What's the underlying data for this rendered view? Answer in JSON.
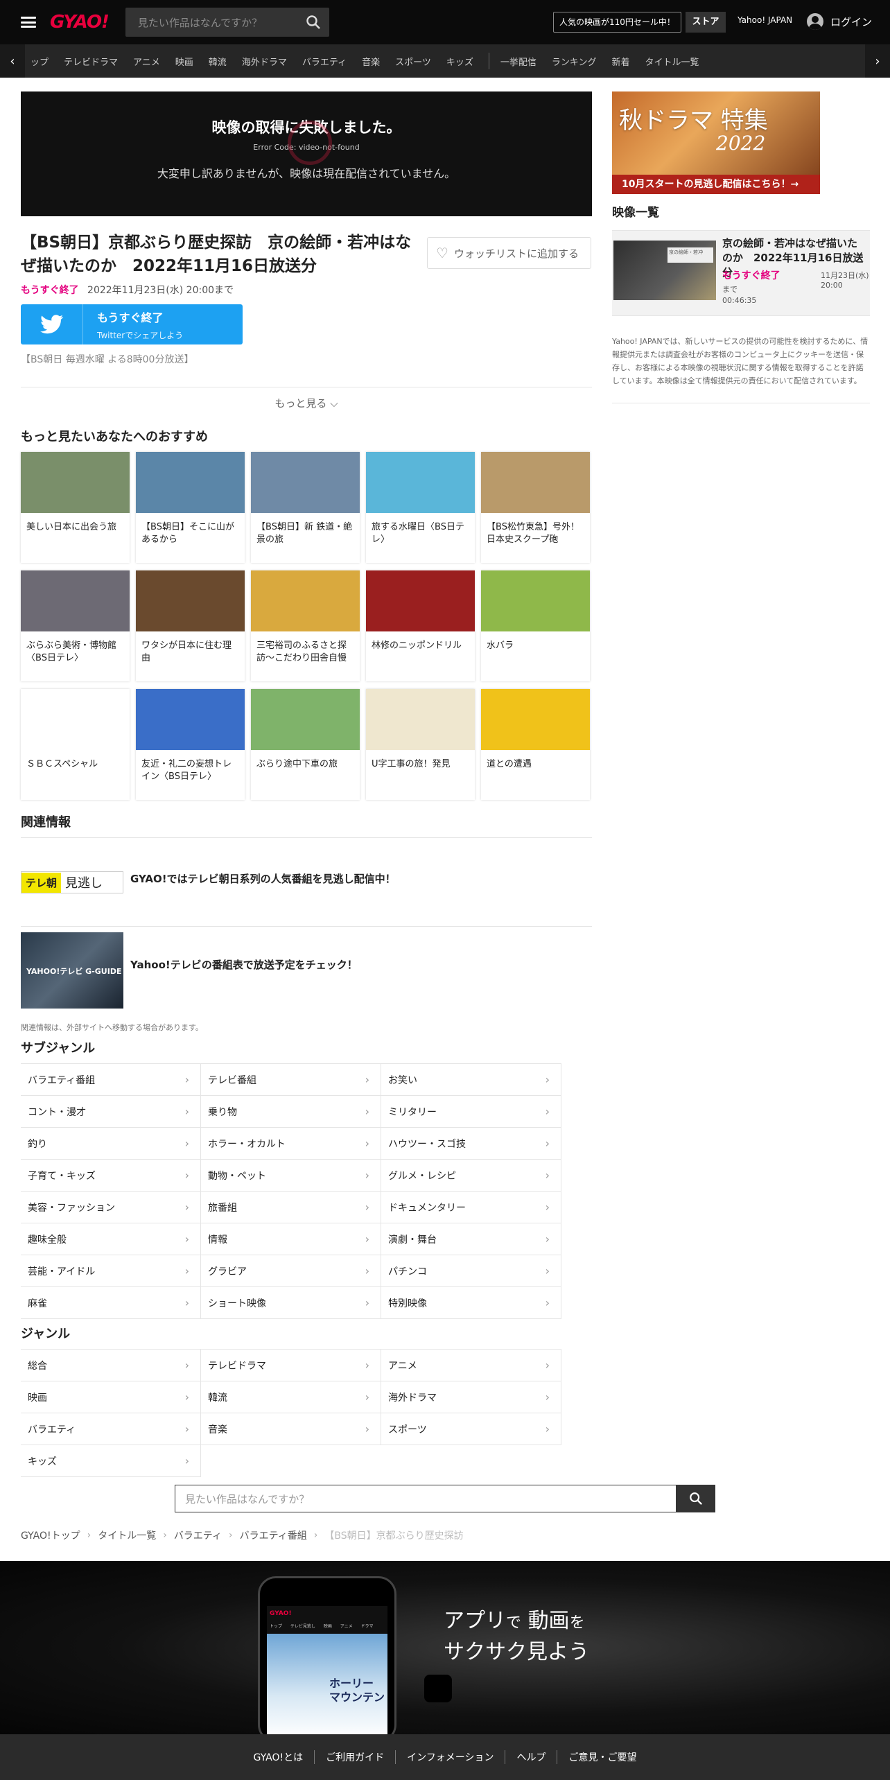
{
  "header": {
    "logo": "GYAO!",
    "search_placeholder": "見たい作品はなんですか？",
    "sale_text": "人気の映画が110円セール中！",
    "store": "ストア",
    "yahoo": "Yahoo! JAPAN",
    "login": "ログイン"
  },
  "nav": {
    "items": [
      "ップ",
      "テレビドラマ",
      "アニメ",
      "映画",
      "韓流",
      "海外ドラマ",
      "バラエティ",
      "音楽",
      "スポーツ",
      "キッズ"
    ],
    "items2": [
      "一挙配信",
      "ランキング",
      "新着",
      "タイトル一覧"
    ]
  },
  "player": {
    "error_title": "映像の取得に失敗しました。",
    "error_code": "Error Code: video-not-found",
    "error_msg": "大変申し訳ありませんが、映像は現在配信されていません。"
  },
  "video": {
    "title": "【BS朝日】京都ぶらり歴史探訪　京の絵師・若冲はなぜ描いたのか　2022年11月16日放送分",
    "watchlist": "ウォッチリストに追加する",
    "status": "もうすぐ終了",
    "until": "2022年11月23日(水) 20:00まで",
    "twitter_l1": "もうすぐ終了",
    "twitter_l2": "Twitterでシェアしよう",
    "broadcast": "【BS朝日 毎週水曜 よる8時00分放送】",
    "more": "もっと見る"
  },
  "recommend": {
    "heading": "もっと見たいあなたへのおすすめ",
    "rows": [
      [
        {
          "title": "美しい日本に出会う旅",
          "color": "#7a8f6a"
        },
        {
          "title": "【BS朝日】そこに山があるから",
          "color": "#5b86a8"
        },
        {
          "title": "【BS朝日】新 鉄道・絶景の旅",
          "color": "#6f8aa6"
        },
        {
          "title": "旅する水曜日〈BS日テレ〉",
          "color": "#5ab6d9"
        },
        {
          "title": "【BS松竹東急】号外！日本史スクープ砲",
          "color": "#b99a6a"
        }
      ],
      [
        {
          "title": "ぶらぶら美術・博物館〈BS日テレ〉",
          "color": "#6d6a74"
        },
        {
          "title": "ワタシが日本に住む理由",
          "color": "#6a4a2e"
        },
        {
          "title": "三宅裕司のふるさと探訪～こだわり田舎自慢",
          "color": "#d9a93e"
        },
        {
          "title": "林修のニッポンドリル",
          "color": "#9a1f1f"
        },
        {
          "title": "水バラ",
          "color": "#8fb84a"
        }
      ],
      [
        {
          "title": "ＳＢＣスペシャル",
          "color": "#ffffff"
        },
        {
          "title": "友近・礼二の妄想トレイン〈BS日テレ〉",
          "color": "#3a6ec8"
        },
        {
          "title": "ぶらり途中下車の旅",
          "color": "#7fb36a"
        },
        {
          "title": "U字工事の旅！発見",
          "color": "#efe7cf"
        },
        {
          "title": "道との遭遇",
          "color": "#f0c21a"
        }
      ]
    ]
  },
  "related": {
    "heading": "関連情報",
    "items": [
      {
        "text": "GYAO!ではテレビ朝日系列の人気番組を見逃し配信中！",
        "img_label": "テレ朝 見逃し"
      },
      {
        "text": "Yahoo!テレビの番組表で放送予定をチェック！",
        "img_label": "YAHOO!テレビ G-GUIDE"
      }
    ],
    "note": "関連情報は、外部サイトへ移動する場合があります。"
  },
  "subgenre": {
    "heading": "サブジャンル",
    "items": [
      "バラエティ番組",
      "テレビ番組",
      "お笑い",
      "コント・漫才",
      "乗り物",
      "ミリタリー",
      "釣り",
      "ホラー・オカルト",
      "ハウツー・スゴ技",
      "子育て・キッズ",
      "動物・ペット",
      "グルメ・レシピ",
      "美容・ファッション",
      "旅番組",
      "ドキュメンタリー",
      "趣味全般",
      "情報",
      "演劇・舞台",
      "芸能・アイドル",
      "グラビア",
      "パチンコ",
      "麻雀",
      "ショート映像",
      "特別映像"
    ]
  },
  "genre": {
    "heading": "ジャンル",
    "items": [
      "総合",
      "テレビドラマ",
      "アニメ",
      "映画",
      "韓流",
      "海外ドラマ",
      "バラエティ",
      "音楽",
      "スポーツ",
      "キッズ"
    ]
  },
  "bottom_search_placeholder": "見たい作品はなんですか？",
  "breadcrumb": [
    "GYAO!トップ",
    "タイトル一覧",
    "バラエティ",
    "バラエティ番組",
    "【BS朝日】京都ぶらり歴史探訪"
  ],
  "banner": {
    "slogan_line1_a": "アプリ",
    "slogan_line1_b": "で",
    "slogan_line1_c": "動画",
    "slogan_line1_d": "を",
    "slogan_line2": "サクサク見よう",
    "phone_logo": "GYAO!",
    "phone_tabs": "トップ テレビ見逃し 映画 アニメ ドラマ",
    "phone_poster": "ホーリー マウンテン"
  },
  "footer": [
    "GYAO!とは",
    "ご利用ガイド",
    "インフォメーション",
    "ヘルプ",
    "ご意見・ご要望"
  ],
  "sidebar": {
    "ad_text": "秋ドラマ 特集",
    "ad_year": "2022",
    "ad_bar": "10月スタートの見逃し配信はこちら！→",
    "list_heading": "映像一覧",
    "item": {
      "title": "京の絵師・若冲はなぜ描いたのか　2022年11月16日放送分",
      "status": "もうすぐ終了",
      "date": "11月23日(水) 20:00",
      "date2": "まで",
      "duration": "00:46:35",
      "thumb_label": "京の絵師・若冲"
    },
    "disclaimer": "Yahoo! JAPANでは、新しいサービスの提供の可能性を検討するために、情報提供元または調査会社がお客様のコンピュータ上にクッキーを送信・保存し、お客様による本映像の視聴状況に関する情報を取得することを許諾しています。本映像は全て情報提供元の責任において配信されています。"
  },
  "colors": {
    "accent": "#e8003d",
    "status": "#e4007f",
    "twitter": "#1da1f2"
  }
}
